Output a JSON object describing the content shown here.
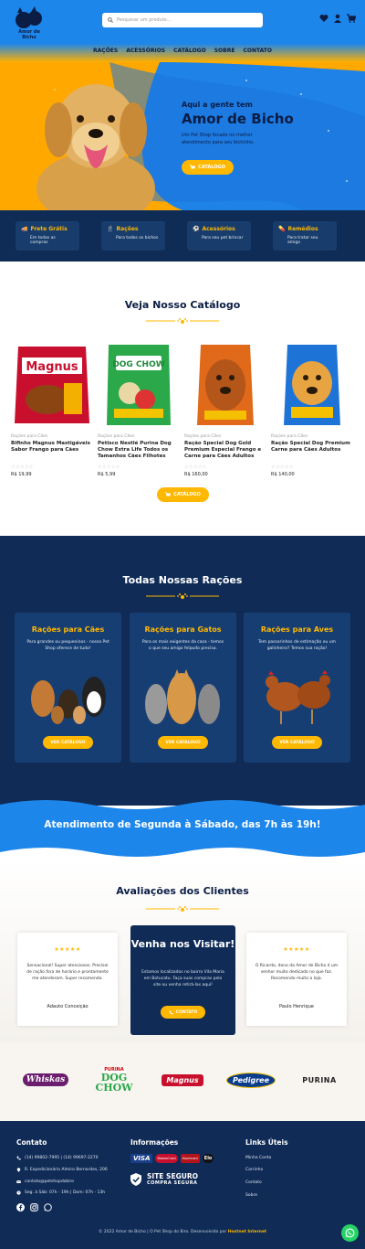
{
  "header": {
    "logo_text": "Amor de Bicho",
    "search_placeholder": "Pesquisar um produto...",
    "nav": [
      "RAÇÕES",
      "ACESSÓRIOS",
      "CATÁLOGO",
      "SOBRE",
      "CONTATO"
    ]
  },
  "hero": {
    "subtitle": "Aqui a gente tem",
    "title": "Amor de Bicho",
    "text": "Um Pet Shop focado no melhor atendimento para seu bichinho.",
    "button": "CATÁLOGO"
  },
  "features": [
    {
      "title": "Frete Grátis",
      "desc": "Em todas as compras",
      "icon": "truck-icon"
    },
    {
      "title": "Rações",
      "desc": "Para todos os bichos",
      "icon": "fork-icon"
    },
    {
      "title": "Acessórios",
      "desc": "Para seu pet brincar",
      "icon": "ball-icon"
    },
    {
      "title": "Remédios",
      "desc": "Para tratar seu amigo",
      "icon": "pill-icon"
    }
  ],
  "catalog": {
    "title": "Veja Nosso Catálogo",
    "button": "CATÁLOGO",
    "products": [
      {
        "category": "Rações para Cães",
        "name": "Bifinho Magnus Mastigáveis Sabor Frango para Cães",
        "stars": "☆☆☆☆☆",
        "price": "R$ 19,99",
        "color": "#d8232a"
      },
      {
        "category": "Rações para Cães",
        "name": "Petisco Nestlé Purina Dog Chow Extra Life Todos os Tamanhos Cães Filhotes",
        "stars": "☆☆☆☆☆",
        "price": "R$ 5,99",
        "color": "#1f9a45"
      },
      {
        "category": "Rações para Cães",
        "name": "Ração Special Dog Gold Premium Especial Frango e Carne para Cães Adultos",
        "stars": "☆☆☆☆☆",
        "price": "R$ 160,00",
        "color": "#e2701d"
      },
      {
        "category": "Rações para Cães",
        "name": "Ração Special Dog Premium Carne para Cães Adultos",
        "stars": "☆☆☆☆☆",
        "price": "R$ 140,00",
        "color": "#1b6fd6"
      }
    ]
  },
  "racoes": {
    "title": "Todas Nossas Rações",
    "cards": [
      {
        "title": "Rações para Cães",
        "desc": "Para grandes ou pequeninos - nosso Pet Shop oferece de tudo!",
        "button": "VER CATÁLOGO"
      },
      {
        "title": "Rações para Gatos",
        "desc": "Para os mais exigentes da casa - temos o que seu amigo felpudo precisa.",
        "button": "VER CATÁLOGO"
      },
      {
        "title": "Rações para Aves",
        "desc": "Tem passarinhos de estimação ou um galinheiro? Temos sua ração!",
        "button": "VER CATÁLOGO"
      }
    ]
  },
  "banner": {
    "text": "Atendimento de Segunda à Sábado, das 7h às 19h!"
  },
  "reviews": {
    "title": "Avaliações dos Clientes",
    "items": [
      {
        "stars": "★★★★★",
        "text": "Sensacional! Super atenciosos. Precisei de ração fora de horário e prontamente me atenderam. Super recomendo.",
        "author": "Adauto Conceição"
      },
      {
        "stars": "★★★★★",
        "text": "O Ricardo, dono da Amor de Bicho é um senhor muito dedicado no que faz. Recomendo muito a loja.",
        "author": "Paulo Henrique"
      }
    ],
    "visit": {
      "title": "Venha nos Visitar!",
      "text": "Estamos localizados no bairro Vila Maria em Botucatu. Faça suas compras pelo site ou venha retirá-las aqui!",
      "button": "CONTATO"
    }
  },
  "brands": [
    "Whiskas",
    "PURINA",
    "DOG CHOW",
    "Magnus",
    "Pedigree",
    "PURINA"
  ],
  "footer": {
    "contato_title": "Contato",
    "phones": "(14) 99802-7995 | (14) 99697-2270",
    "address": "R. Expedicionário Almiro Bernardes, 206",
    "email": "contato@petshopdobiro",
    "hours": "Seg. à Sáb: 07h - 19h | Dom: 07h - 13h",
    "info_title": "Informações",
    "secure_1": "SITE SEGURO",
    "secure_2": "COMPRA SEGURA",
    "payments": [
      "VISA",
      "MasterCard",
      "Hipercard",
      "Elo"
    ],
    "links_title": "Links Úteis",
    "links": [
      "Minha Conta",
      "Carrinho",
      "Contato",
      "Sobre"
    ],
    "copyright": "© 2022 Amor de Bicho | O Pet Shop do Biro. Desenvolvido por",
    "developer": "Hostnet Internet"
  },
  "colors": {
    "navy": "#0f2b56",
    "accent": "#ffb800",
    "blue": "#1d86ea"
  }
}
